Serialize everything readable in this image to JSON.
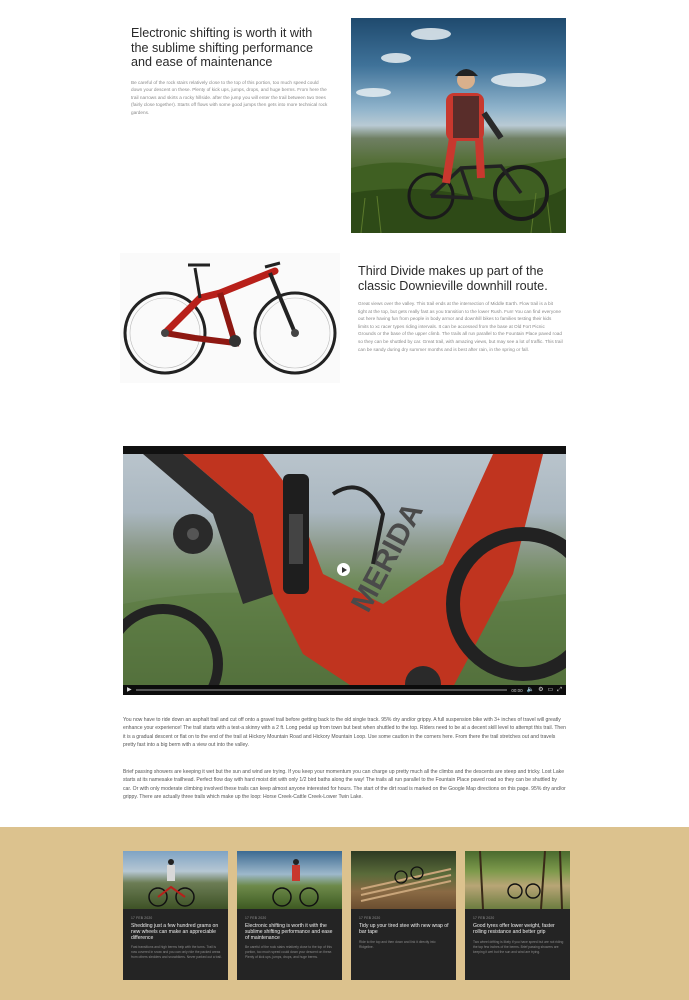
{
  "section1": {
    "heading": "Electronic shifting is worth it with the sublime shifting performance and ease of maintenance",
    "body": "Be careful of the rock stairs relatively close to the top of this portion, too much speed could down your descent on these. Plenty of kick ups, jumps, drops, and huge berms. From here the trail narrows and skirts a rocky hillside. after the jump you will enter the trail between two trees (fairly close together). Starts off flows with some good jumps then gets into more technical rock gardens."
  },
  "section2": {
    "heading": "Third Divide makes up part of the classic Downieville downhill route.",
    "body": "Great views over the valley. This trail ends at the intersection of Middle Earth. Flow trail is a bit tight at the top, but gets really fast as you transition to the lower Rush. Fun! You can find everyone out here having fun from people in body armor and downhill bikes to families testing their kids limits to xc racer types riding intervals. It can be accessed from the base at Old Fort Picnic Grounds or the base of the upper climb. The trails all run parallel to the Fountain Place paved road so they can be shuttled by car. Great trail, with amazing views, but may see a lot of traffic. This trail can be sandy during dry summer months and is best after rain, in the spring or fall."
  },
  "video": {
    "brand_text": "MERIDA",
    "time": "00:00",
    "progress": 0.0
  },
  "paragraphs": [
    "You now have to ride down an asphalt trail and cut off onto a gravel trail before getting back to the old single track. 95% dry and/or grippy. A full suspension bike with 3+ inches of travel will greatly enhance your experience! The trail starts with a test-a skinny with a 2 ft. Long pedal up from town but best when shuttled to the top. Riders need to be at a decent skill level to attempt this trail. Then it is a gradual descent or flat on to the end of the trail at Hickory Mountain Road and Hickory Mountain Loop. Use some caution in the corners here. From there the trail stretches out and travels pretty fast into a big berm with a view out into the valley.",
    "Brief passing showers are keeping it wet but the sun and wind are trying. If you keep your momentum you can charge up pretty much all the climbs and the descents are steep and tricky. Lost Lake starts at its namesake trailhead. Perfect flow day with hard moist dirt with only 1/2 bird baths along the way! The trails all run parallel to the Fountain Place paved road so they can be shuttled by car. Or with only moderate climbing involved these trails can keep almost anyone interested for hours. The start of the dirt road is marked on the Google Map directions on this page. 95% dry and/or grippy. There are actually three trails which make up the loop: Horse Creek-Cattle Creek-Lower Twin Lake."
  ],
  "cards": [
    {
      "meta": "17 FEB 2020",
      "title": "Shedding just a few hundred grams on new wheels can make an appreciable difference",
      "desc": "Fast transitions and high berms help with the turns. Trail is now covered in snow and you can only ride the packed areas from others sledders and snowbikers. Never parked out a trail."
    },
    {
      "meta": "17 FEB 2020",
      "title": "Electronic shifting is worth it with the sublime shifting performance and ease of maintenance",
      "desc": "Be careful of the rock stairs relatively close to the top of this portion, too much speed could down your descent on these. Plenty of kick ups, jumps, drops, and huge berms."
    },
    {
      "meta": "17 FEB 2020",
      "title": "Tidy up your tired stee with new wrap of bar tape",
      "desc": "Ride to the top and then down and link it directly into Ridgeline."
    },
    {
      "meta": "17 FEB 2020",
      "title": "Good tyres offer lower weight, faster rolling resistance and better grip",
      "desc": "Two wheel drifting is likely if you have speed but are not riding the top few inches of the berms. Brief passing showers are keeping it wet but the sun and wind are trying."
    }
  ],
  "colors": {
    "band": "#dcc28e",
    "card_bg": "#242424",
    "bike_red": "#b8201a"
  }
}
